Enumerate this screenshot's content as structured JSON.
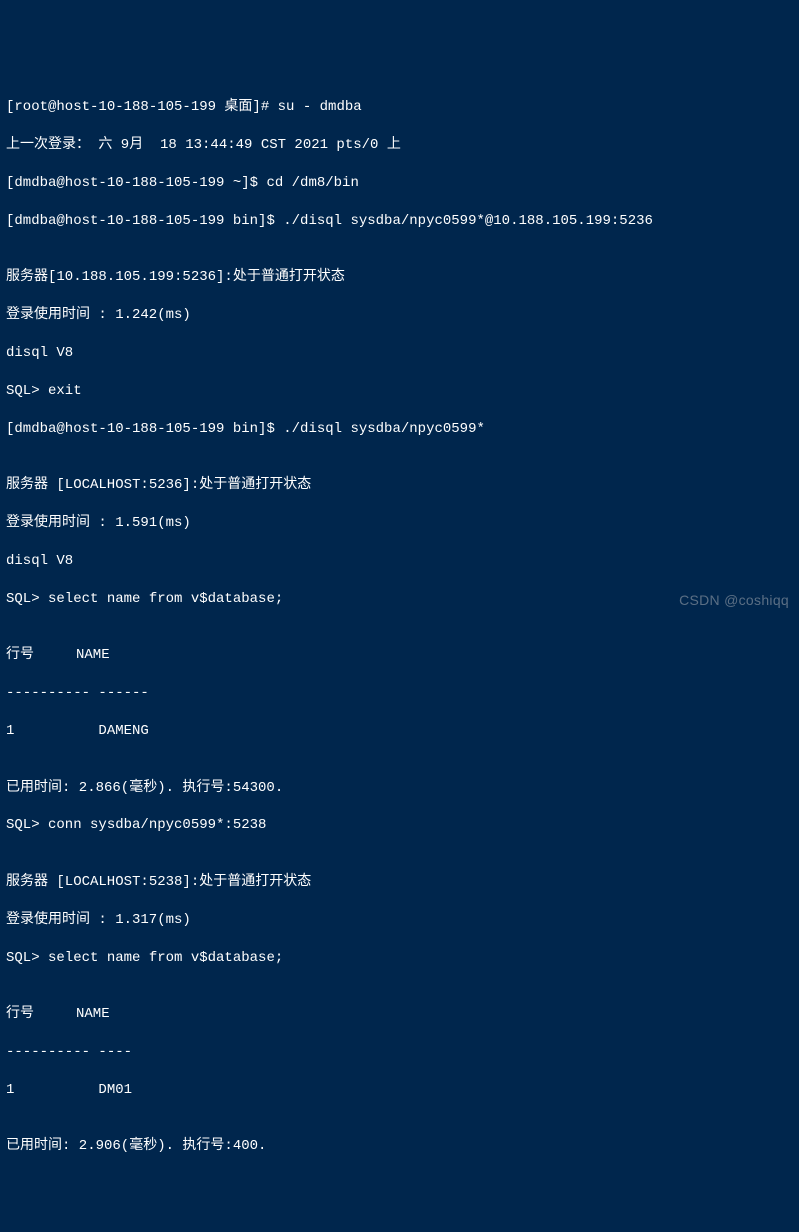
{
  "lines": {
    "l1": "[root@host-10-188-105-199 桌面]# su - dmdba",
    "l2": "上一次登录： 六 9月  18 13:44:49 CST 2021 pts/0 上",
    "l3": "[dmdba@host-10-188-105-199 ~]$ cd /dm8/bin",
    "l4": "[dmdba@host-10-188-105-199 bin]$ ./disql sysdba/npyc0599*@10.188.105.199:5236",
    "l5": "",
    "l6": "服务器[10.188.105.199:5236]:处于普通打开状态",
    "l7": "登录使用时间 : 1.242(ms)",
    "l8": "disql V8",
    "l9": "SQL> exit",
    "l10": "[dmdba@host-10-188-105-199 bin]$ ./disql sysdba/npyc0599*",
    "l11": "",
    "l12": "服务器 [LOCALHOST:5236]:处于普通打开状态",
    "l13": "登录使用时间 : 1.591(ms)",
    "l14": "disql V8",
    "l15": "SQL> select name from v$database;",
    "l16": "",
    "l17": "行号     NAME",
    "l18": "---------- ------",
    "l19": "1          DAMENG",
    "l20": "",
    "l21": "已用时间: 2.866(毫秒). 执行号:54300.",
    "l22": "SQL> conn sysdba/npyc0599*:5238",
    "l23": "",
    "l24": "服务器 [LOCALHOST:5238]:处于普通打开状态",
    "l25": "登录使用时间 : 1.317(ms)",
    "l26": "SQL> select name from v$database;",
    "l27": "",
    "l28": "行号     NAME",
    "l29": "---------- ----",
    "l30": "1          DM01",
    "l31": "",
    "l32": "已用时间: 2.906(毫秒). 执行号:400."
  },
  "watermark": "CSDN @coshiqq"
}
